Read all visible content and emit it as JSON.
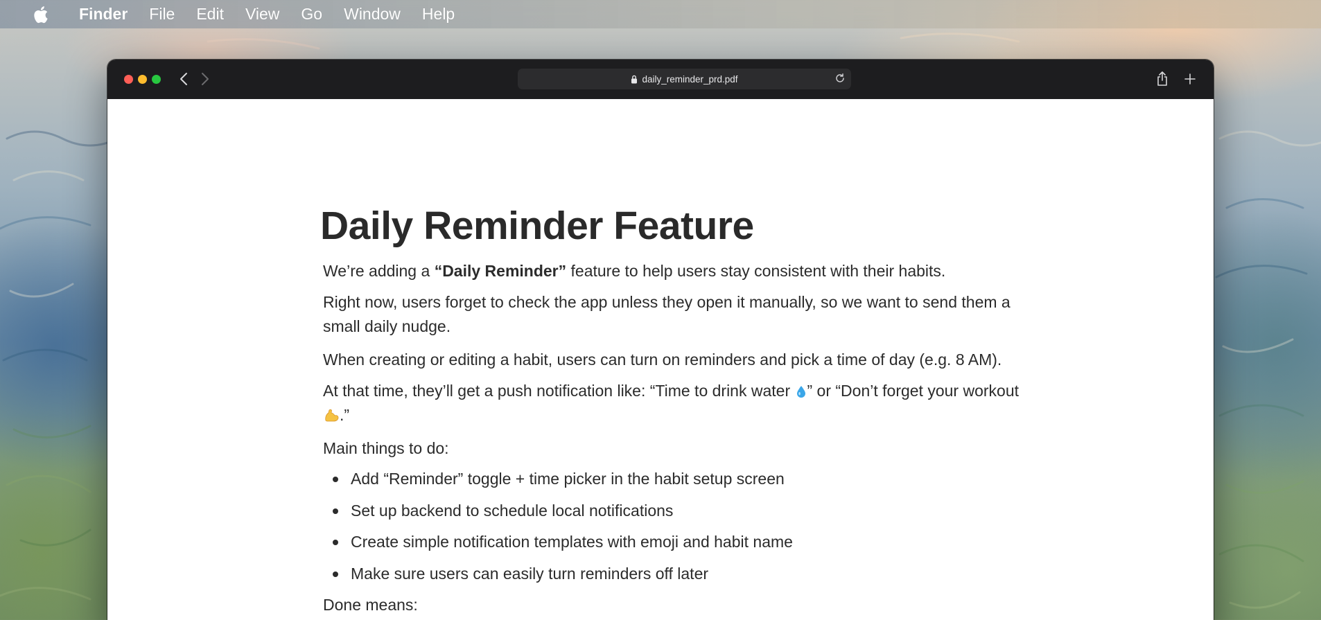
{
  "menubar": {
    "apple_icon": "apple-logo-icon",
    "items": [
      "Finder",
      "File",
      "Edit",
      "View",
      "Go",
      "Window",
      "Help"
    ]
  },
  "window": {
    "url": "daily_reminder_prd.pdf",
    "icons": [
      "back-icon",
      "forward-icon",
      "lock-icon",
      "reload-icon",
      "share-icon",
      "new-tab-icon"
    ]
  },
  "document": {
    "title": "Daily Reminder Feature",
    "intro_prefix": "We’re adding a ",
    "intro_bold": "“Daily Reminder”",
    "intro_suffix": " feature to help users stay consistent with their habits.",
    "para2": "Right now, users forget to check the app unless they open it manually, so we want to send them a small daily nudge.",
    "para3": "When creating or editing a habit, users can turn on reminders and pick a time of day (e.g. 8 AM).",
    "para4_a": "At that time, they’ll get a push notification like: “Time to drink water ",
    "para4_b": "” or “Don’t forget your workout ",
    "para4_c": ".”",
    "main_things": "Main things to do:",
    "tasks": [
      "Add “Reminder” toggle + time picker in the habit setup screen",
      "Set up backend to schedule local notifications",
      "Create simple notification templates with emoji and habit name",
      "Make sure users can easily turn reminders off later"
    ],
    "done_means": "Done means:"
  }
}
